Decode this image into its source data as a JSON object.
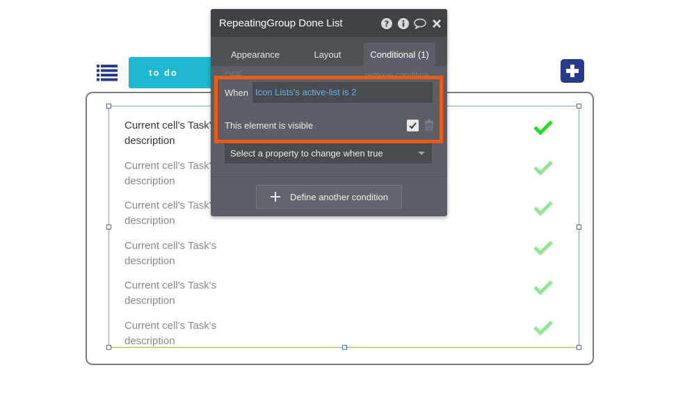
{
  "toolbar": {
    "todo_label": "to do"
  },
  "list": {
    "rows": [
      {
        "line1": "Current cell's Task's",
        "line2": "description"
      },
      {
        "line1": "Current cell's Task's",
        "line2": "description"
      },
      {
        "line1": "Current cell's Task's",
        "line2": "description"
      },
      {
        "line1": "Current cell's Task's",
        "line2": "description"
      },
      {
        "line1": "Current cell's Task's",
        "line2": "description"
      },
      {
        "line1": "Current cell's Task's",
        "line2": "description"
      }
    ],
    "check_colors": {
      "active": "#22dd22",
      "inactive": "#8fe88f"
    }
  },
  "panel": {
    "title": "RepeatingGroup Done List",
    "tabs": [
      {
        "label": "Appearance",
        "active": false
      },
      {
        "label": "Layout",
        "active": false
      },
      {
        "label": "Conditional (1)",
        "active": true
      }
    ],
    "faded_left": "OFF",
    "faded_right": "remove condition",
    "when_label": "When",
    "when_value": "Icon Lists's active-list is 2",
    "visible_label": "This element is visible",
    "visible_checked": true,
    "select_placeholder": "Select a property to change when true",
    "define_button": "Define another condition",
    "highlight_color": "#f05a19"
  }
}
